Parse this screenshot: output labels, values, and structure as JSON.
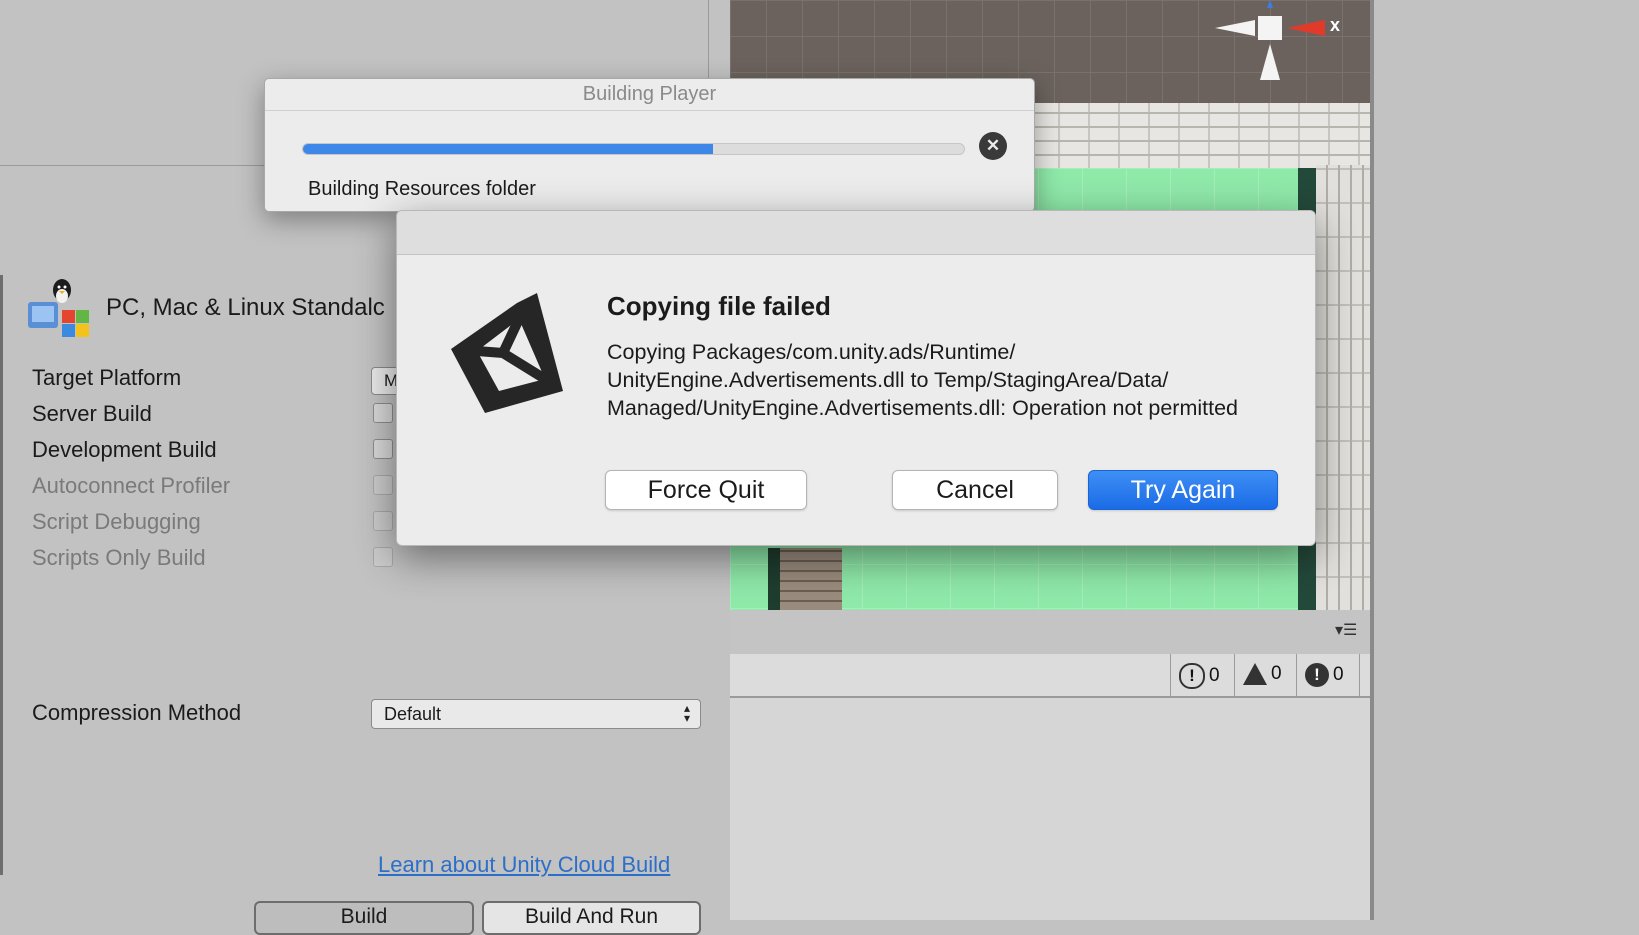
{
  "progress_window": {
    "title": "Building Player",
    "status": "Building Resources folder",
    "progress_fraction": 0.62
  },
  "dialog": {
    "heading": "Copying file failed",
    "message": "Copying Packages/com.unity.ads/Runtime/ UnityEngine.Advertisements.dll to Temp/StagingArea/Data/ Managed/UnityEngine.Advertisements.dll: Operation not permitted",
    "buttons": {
      "force_quit": "Force Quit",
      "cancel": "Cancel",
      "try_again": "Try Again"
    },
    "accent_color": "#2a7bee"
  },
  "build_settings": {
    "platform_title": "PC, Mac & Linux Standalc",
    "target_platform_label": "Target Platform",
    "target_platform_value": "M",
    "options": [
      {
        "label": "Server Build",
        "enabled": true
      },
      {
        "label": "Development Build",
        "enabled": true
      },
      {
        "label": "Autoconnect Profiler",
        "enabled": false
      },
      {
        "label": "Script Debugging",
        "enabled": false
      },
      {
        "label": "Scripts Only Build",
        "enabled": false
      }
    ],
    "compression_label": "Compression Method",
    "compression_value": "Default",
    "cloud_link": "Learn about Unity Cloud Build",
    "build_button": "Build",
    "build_and_run_button": "Build And Run"
  },
  "scene": {
    "gizmo_axis": "x"
  },
  "console": {
    "info_count": "0",
    "warning_count": "0",
    "error_count": "0",
    "info_icon": "info-icon",
    "warning_icon": "warning-icon",
    "error_icon": "error-icon"
  }
}
